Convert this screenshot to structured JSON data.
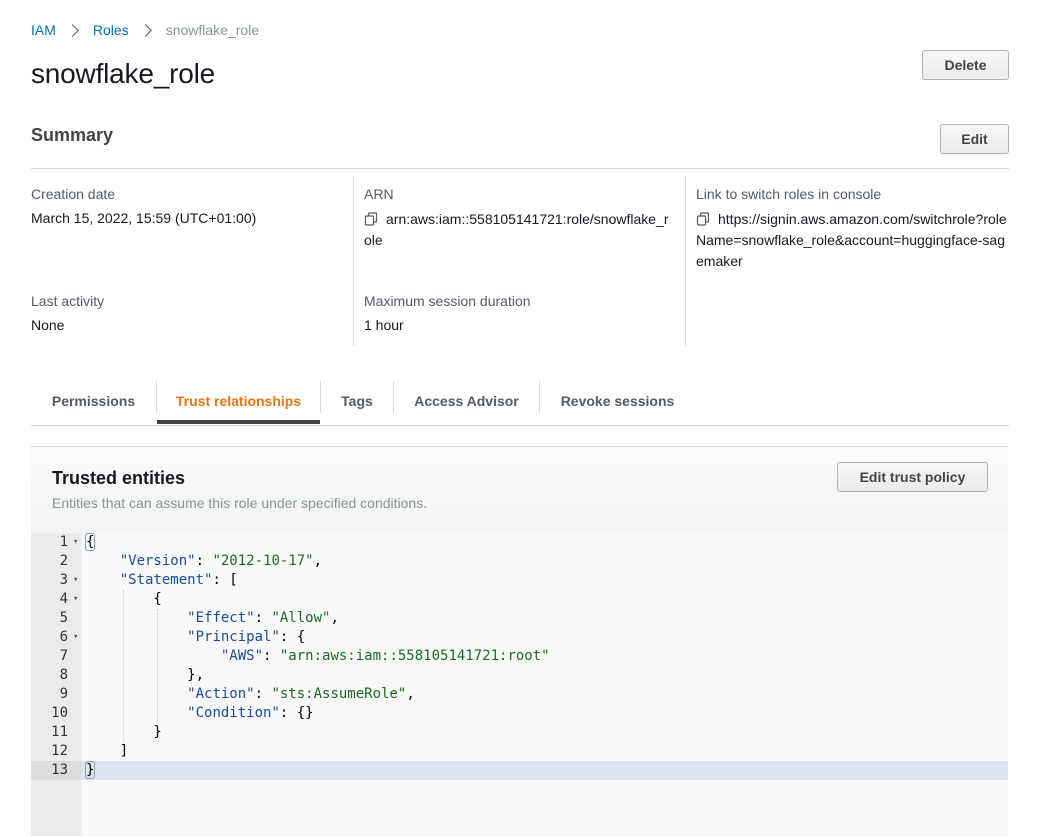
{
  "breadcrumb": {
    "items": [
      {
        "label": "IAM",
        "link": true
      },
      {
        "label": "Roles",
        "link": true
      },
      {
        "label": "snowflake_role",
        "link": false
      }
    ]
  },
  "header": {
    "title": "snowflake_role",
    "delete_label": "Delete"
  },
  "summary": {
    "title": "Summary",
    "edit_label": "Edit",
    "creation_date": {
      "label": "Creation date",
      "value": "March 15, 2022, 15:59 (UTC+01:00)"
    },
    "last_activity": {
      "label": "Last activity",
      "value": "None"
    },
    "arn": {
      "label": "ARN",
      "value": "arn:aws:iam::558105141721:role/snowflake_role",
      "icon": "copy-icon"
    },
    "max_session": {
      "label": "Maximum session duration",
      "value": "1 hour"
    },
    "switch_link": {
      "label": "Link to switch roles in console",
      "value": "https://signin.aws.amazon.com/switchrole?roleName=snowflake_role&account=huggingface-sagemaker",
      "icon": "copy-icon"
    }
  },
  "tabs": {
    "items": [
      {
        "label": "Permissions",
        "active": false
      },
      {
        "label": "Trust relationships",
        "active": true
      },
      {
        "label": "Tags",
        "active": false
      },
      {
        "label": "Access Advisor",
        "active": false
      },
      {
        "label": "Revoke sessions",
        "active": false
      }
    ]
  },
  "trusted_entities": {
    "title": "Trusted entities",
    "description": "Entities that can assume this role under specified conditions.",
    "edit_label": "Edit trust policy",
    "active_line": 13,
    "code_lines": [
      {
        "n": "1",
        "fold": true,
        "text": "{"
      },
      {
        "n": "2",
        "fold": false,
        "text": "    \"Version\": \"2012-10-17\","
      },
      {
        "n": "3",
        "fold": true,
        "text": "    \"Statement\": ["
      },
      {
        "n": "4",
        "fold": true,
        "text": "        {"
      },
      {
        "n": "5",
        "fold": false,
        "text": "            \"Effect\": \"Allow\","
      },
      {
        "n": "6",
        "fold": true,
        "text": "            \"Principal\": {"
      },
      {
        "n": "7",
        "fold": false,
        "text": "                \"AWS\": \"arn:aws:iam::558105141721:root\""
      },
      {
        "n": "8",
        "fold": false,
        "text": "            },"
      },
      {
        "n": "9",
        "fold": false,
        "text": "            \"Action\": \"sts:AssumeRole\","
      },
      {
        "n": "10",
        "fold": false,
        "text": "            \"Condition\": {}"
      },
      {
        "n": "11",
        "fold": false,
        "text": "        }"
      },
      {
        "n": "12",
        "fold": false,
        "text": "    ]"
      },
      {
        "n": "13",
        "fold": false,
        "text": "}"
      }
    ]
  },
  "colors": {
    "link": "#0073bb",
    "active_tab": "#ec7211",
    "json_key": "#1a4d97",
    "json_string": "#1a6b22",
    "active_line_bg": "#dde3ee"
  }
}
